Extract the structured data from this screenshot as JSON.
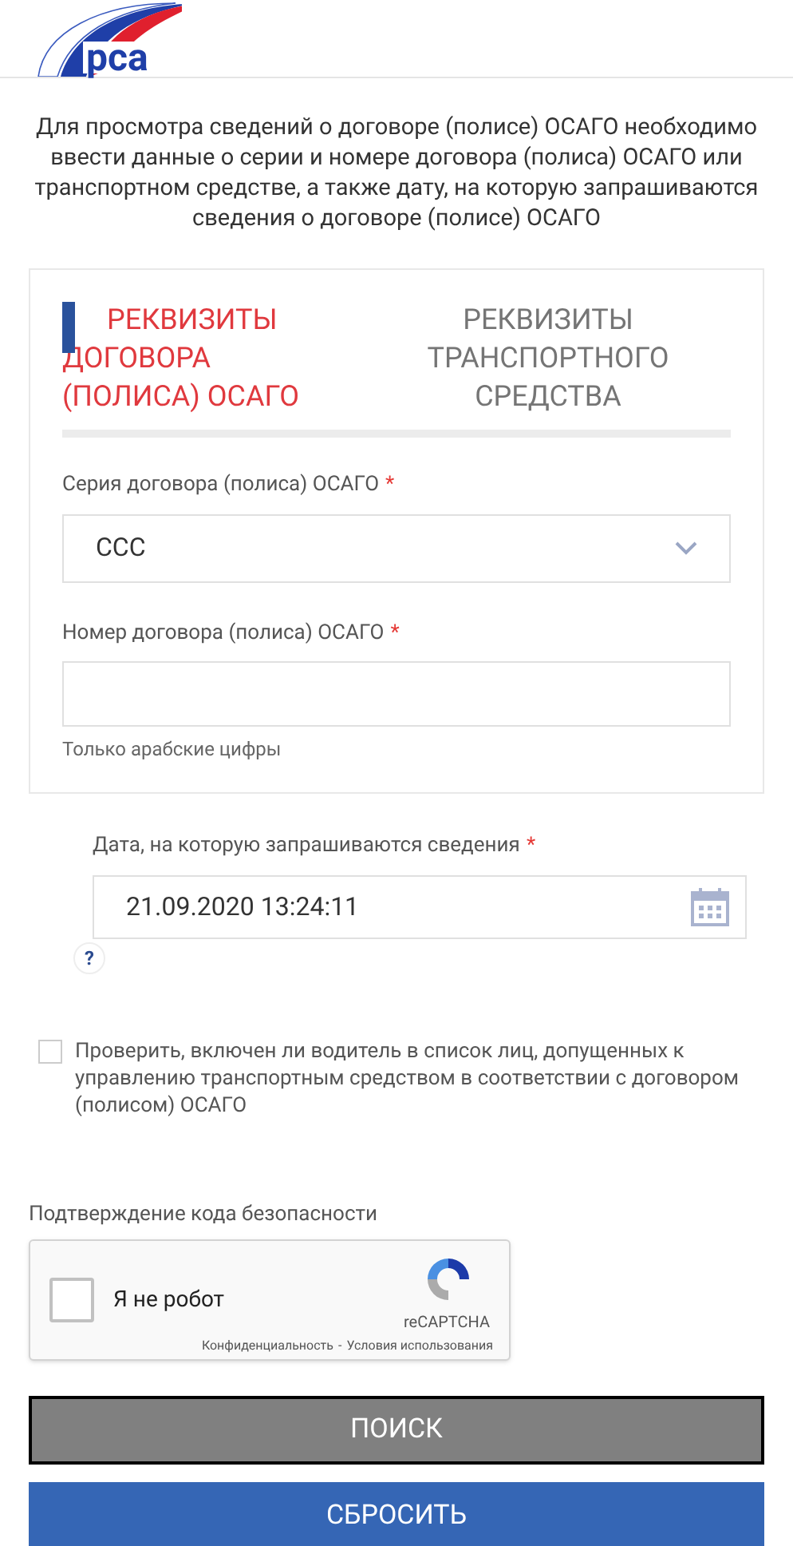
{
  "logo": {
    "text": "рса"
  },
  "intro": "Для просмотра сведений о договоре (полисе) ОСАГО необходимо ввести данные о серии и номере договора (полиса) ОСАГО или транспортном средстве, а также дату, на которую запрашиваются сведения о договоре (полисе) ОСАГО",
  "tabs": [
    {
      "label": "РЕКВИЗИТЫ ДОГОВОРА (ПОЛИСА) ОСАГО",
      "selected": true
    },
    {
      "label": "РЕКВИЗИТЫ ТРАНСПОРТНОГО СРЕДСТВА",
      "selected": false
    }
  ],
  "series_field": {
    "label": "Серия договора (полиса) ОСАГО",
    "required_mark": "*",
    "value": "ССС"
  },
  "number_field": {
    "label": "Номер договора (полиса) ОСАГО",
    "required_mark": "*",
    "hint": "Только арабские цифры"
  },
  "date_field": {
    "label": "Дата, на которую запрашиваются сведения",
    "required_mark": "*",
    "value": "21.09.2020 13:24:11",
    "help": "?"
  },
  "driver_check": {
    "label": "Проверить, включен ли водитель в список лиц, допущенных к управлению транспортным средством в соответствии с договором (полисом) ОСАГО",
    "checked": false
  },
  "captcha": {
    "title": "Подтверждение кода безопасности",
    "label": "Я не робот",
    "checked": false,
    "brand": "reCAPTCHA",
    "privacy": "Конфиденциальность",
    "separator": "-",
    "terms": "Условия использования"
  },
  "buttons": [
    {
      "label": "ПОИСК",
      "kind": "search"
    },
    {
      "label": "СБРОСИТЬ",
      "kind": "reset"
    }
  ]
}
